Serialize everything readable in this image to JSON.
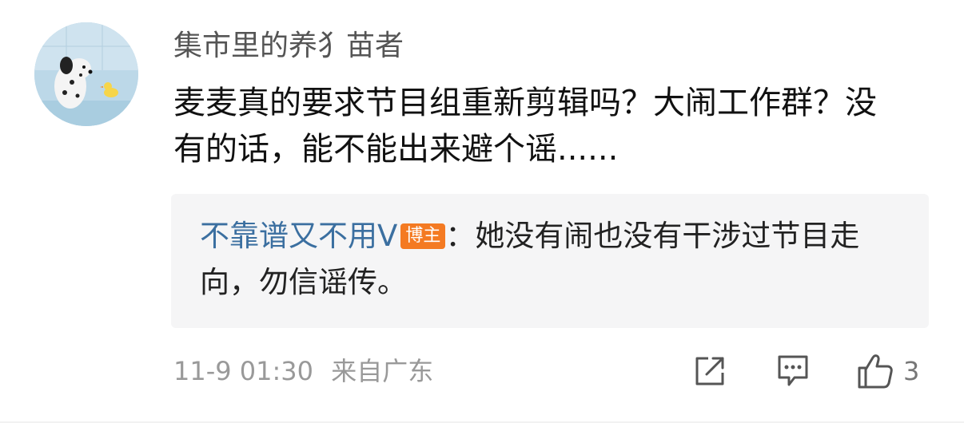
{
  "comment": {
    "username": "集市里的养犭苗者",
    "text": "麦麦真的要求节目组重新剪辑吗？大闹工作群？没有的话，能不能出来避个谣......",
    "reply": {
      "author": "不靠谱又不用V",
      "badge": "博主",
      "text": "：她没有闹也没有干涉过节目走向，勿信谣传。"
    },
    "meta": {
      "time": "11-9 01:30",
      "location": "来自广东"
    },
    "actions": {
      "like_count": "3"
    }
  }
}
